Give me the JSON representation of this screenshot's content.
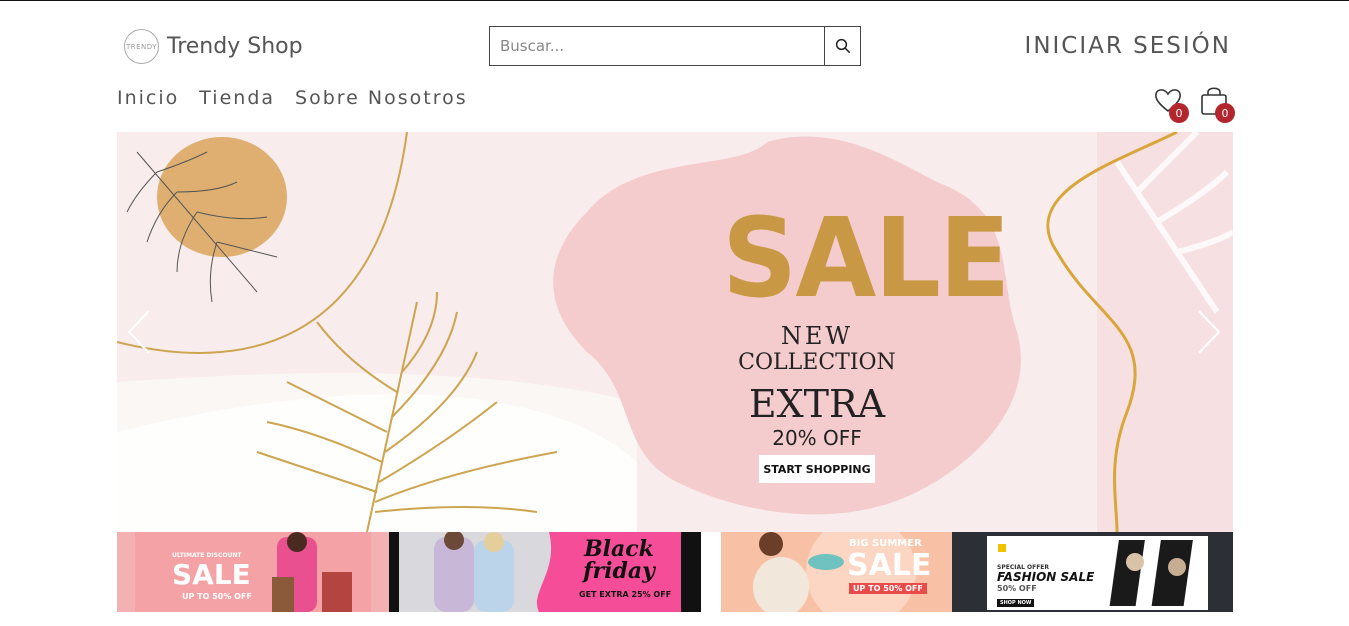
{
  "brand": {
    "logo_mark": "TRENDY",
    "name": "Trendy Shop"
  },
  "search": {
    "placeholder": "Buscar...",
    "button_icon": "search-icon"
  },
  "header": {
    "login_label": "INICIAR SESIÓN"
  },
  "nav": {
    "items": [
      {
        "label": "Inicio"
      },
      {
        "label": "Tienda"
      },
      {
        "label": "Sobre Nosotros"
      }
    ]
  },
  "header_icons": {
    "wishlist_count": "0",
    "cart_count": "0"
  },
  "hero": {
    "title": "SALE",
    "line1": "NEW",
    "line2": "COLLECTION",
    "line3": "EXTRA",
    "line4": "20% OFF",
    "cta": "START SHOPPING"
  },
  "thumbnails": [
    {
      "title": "SALE",
      "eyebrow": "ULTIMATE DISCOUNT",
      "subtitle": "UP TO 50% OFF"
    },
    {
      "title": "Black friday",
      "subtitle": "GET EXTRA 25% OFF"
    },
    {
      "eyebrow": "BIG SUMMER",
      "title": "SALE",
      "subtitle": "UP TO 50% OFF"
    },
    {
      "eyebrow": "SPECIAL OFFER",
      "title": "FASHION SALE",
      "subtitle": "50% OFF",
      "cta": "SHOP NOW"
    }
  ],
  "colors": {
    "accent_badge": "#b3262d",
    "sale_gold": "#c99845",
    "hero_pink": "#f7e8ea"
  }
}
